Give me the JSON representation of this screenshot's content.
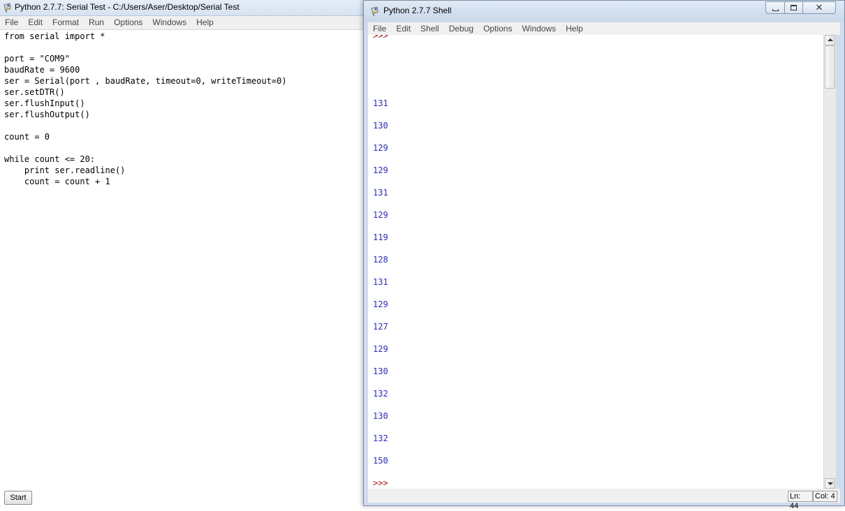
{
  "editor": {
    "title": "Python 2.7.7: Serial Test - C:/Users/Aser/Desktop/Serial Test",
    "menu": [
      "File",
      "Edit",
      "Format",
      "Run",
      "Options",
      "Windows",
      "Help"
    ],
    "code": "from serial import *\n\nport = \"COM9\"\nbaudRate = 9600\nser = Serial(port , baudRate, timeout=0, writeTimeout=0)\nser.setDTR()\nser.flushInput()\nser.flushOutput()\n\ncount = 0\n\nwhile count <= 20:\n    print ser.readline()\n    count = count + 1",
    "start_label": "Start"
  },
  "shell": {
    "title": "Python 2.7.7 Shell",
    "menu": [
      "File",
      "Edit",
      "Shell",
      "Debug",
      "Options",
      "Windows",
      "Help"
    ],
    "top_prompt": ">>>",
    "outputs": [
      "131",
      "130",
      "129",
      "129",
      "131",
      "129",
      "119",
      "128",
      "131",
      "129",
      "127",
      "129",
      "130",
      "132",
      "130",
      "132",
      "150"
    ],
    "bottom_prompt": ">>>",
    "status": {
      "ln": "Ln: 44",
      "col": "Col: 4"
    }
  },
  "colors": {
    "output_text": "#2a2ad0",
    "prompt_text": "#b01010"
  },
  "icons": {
    "app_icon": "python-idle-icon",
    "minimize": "minimize-icon",
    "maximize": "maximize-icon",
    "close": "close-icon"
  }
}
